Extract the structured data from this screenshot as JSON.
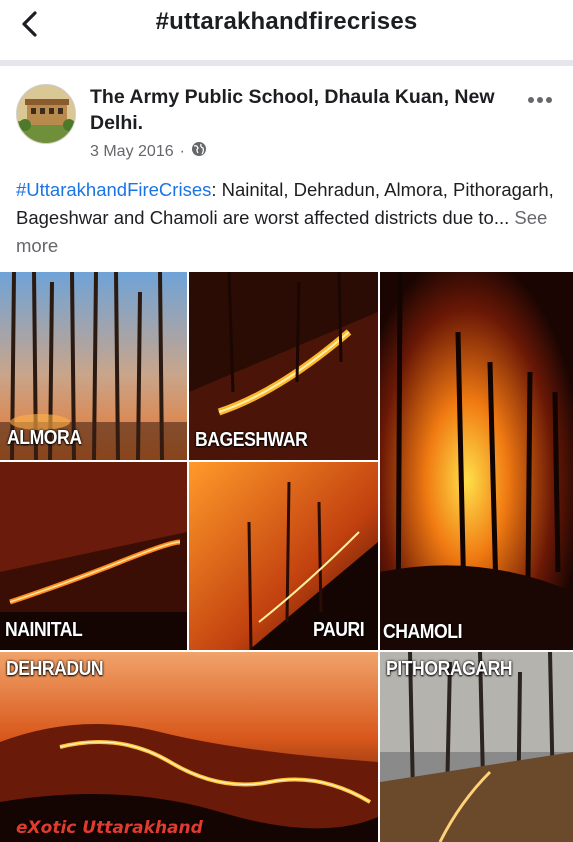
{
  "header": {
    "title": "#uttarakhandfirecrises",
    "back_icon": "chevron-left-icon"
  },
  "post": {
    "author": "The Army Public School, Dhaula Kuan, New Delhi.",
    "date": "3 May 2016",
    "separator": "·",
    "privacy_icon": "globe-icon",
    "more_icon": "ellipsis-icon",
    "hashtag": "#UttarakhandFireCrises",
    "body": ": Nainital, Dehradun, Almora, Pithoragarh, Bageshwar and Chamoli are worst affected districts due to...",
    "see_more": "See more"
  },
  "collage": {
    "labels": {
      "almora": "ALMORA",
      "bageshwar": "BAGESHWAR",
      "chamoli": "CHAMOLI",
      "nainital": "NAINITAL",
      "pauri": "PAURI",
      "dehradun": "DEHRADUN",
      "pithoragarh": "PITHORAGARH"
    },
    "watermark": "eXotic Uttarakhand"
  },
  "colors": {
    "hashtag": "#1b74e4",
    "meta": "#65676b",
    "watermark": "#e23b2e"
  }
}
